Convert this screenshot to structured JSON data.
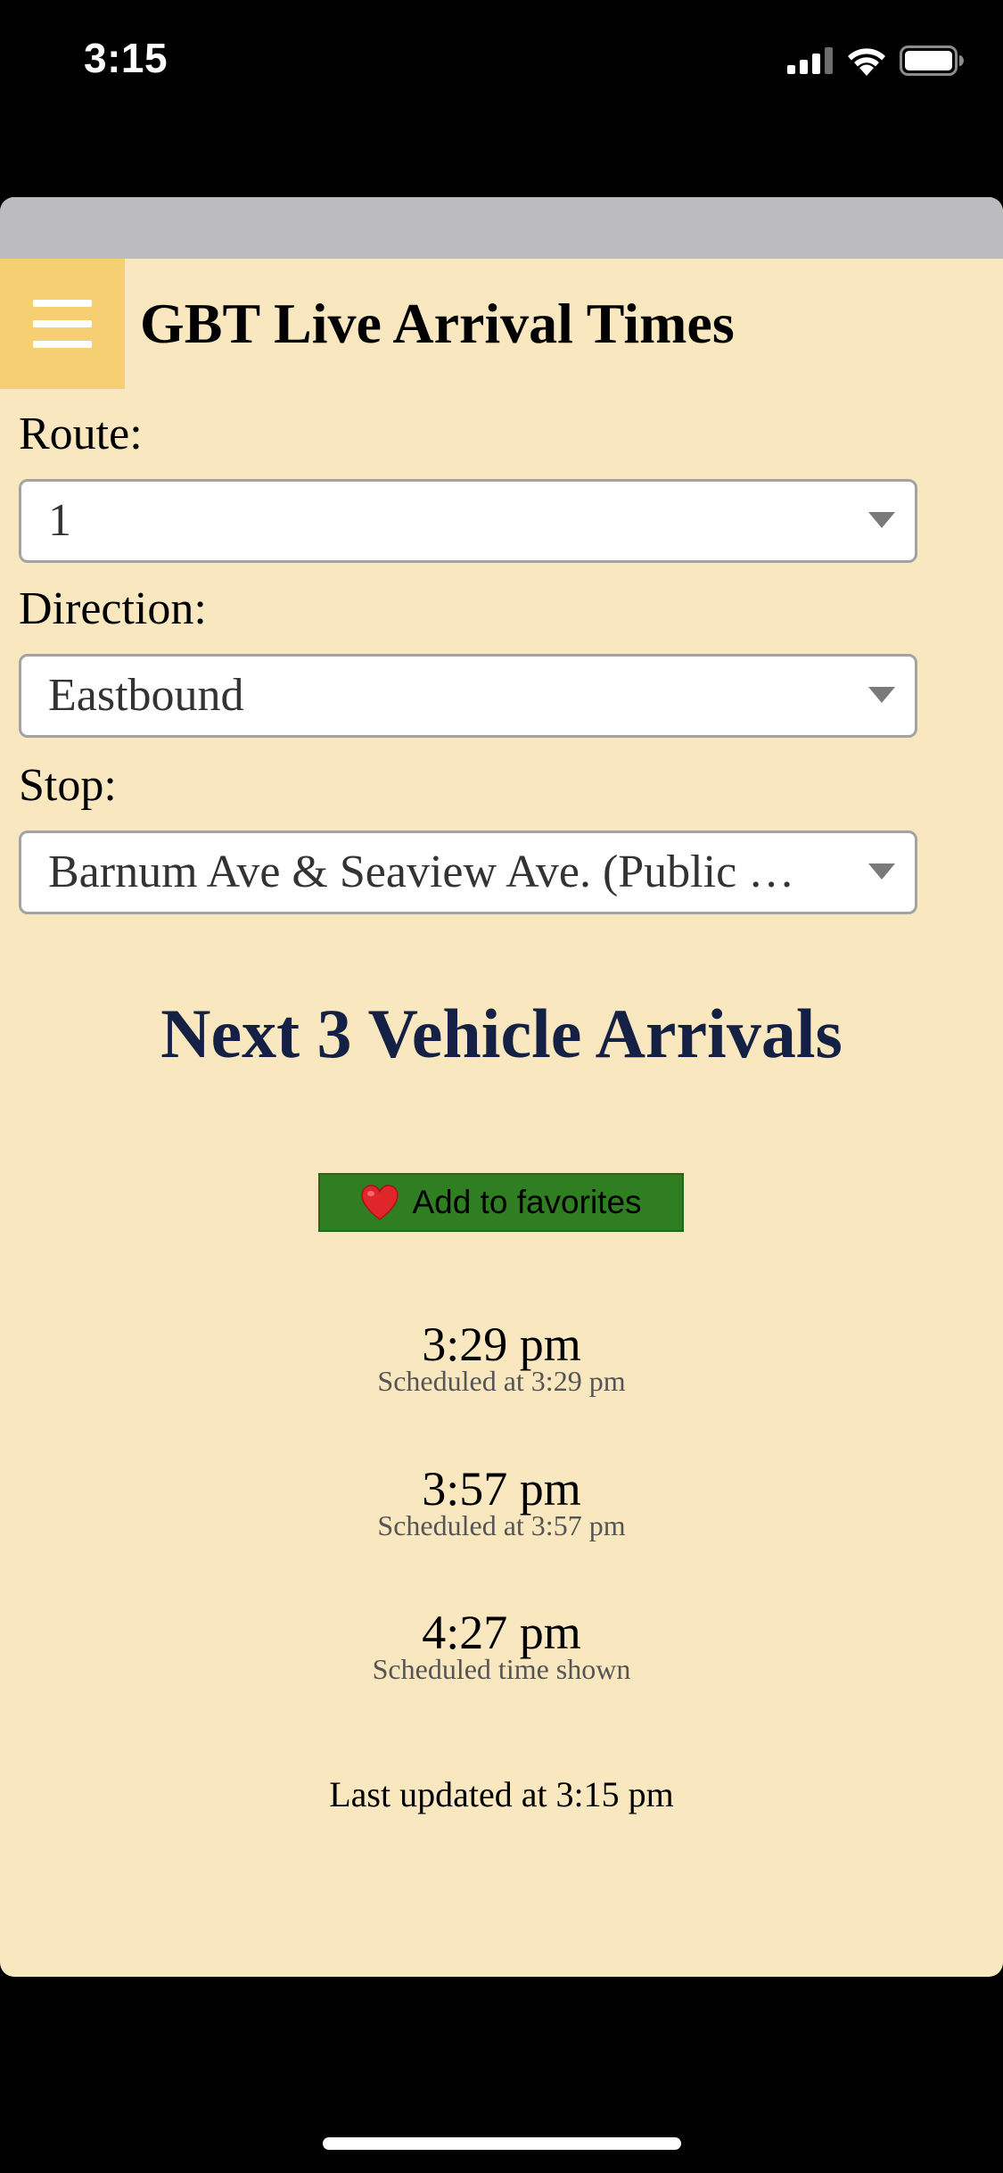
{
  "status_bar": {
    "time": "3:15"
  },
  "header": {
    "title": "GBT Live Arrival Times",
    "menu_icon": "hamburger-menu-icon"
  },
  "form": {
    "route": {
      "label": "Route:",
      "value": "1"
    },
    "direction": {
      "label": "Direction:",
      "value": "Eastbound"
    },
    "stop": {
      "label": "Stop:",
      "value": "Barnum Ave & Seaview Ave. (Public Market)"
    }
  },
  "arrivals_heading": "Next 3 Vehicle Arrivals",
  "favorites_button": {
    "label": "Add to favorites",
    "icon": "heart-icon",
    "color": "#2f7e21"
  },
  "arrivals": [
    {
      "time": "3:29 pm",
      "note": "Scheduled at 3:29 pm"
    },
    {
      "time": "3:57 pm",
      "note": "Scheduled at 3:57 pm"
    },
    {
      "time": "4:27 pm",
      "note": "Scheduled time shown"
    }
  ],
  "last_updated": "Last updated at 3:15 pm",
  "colors": {
    "background": "#f9e8bf",
    "menu_button": "#f6cf72",
    "heading": "#142044"
  }
}
